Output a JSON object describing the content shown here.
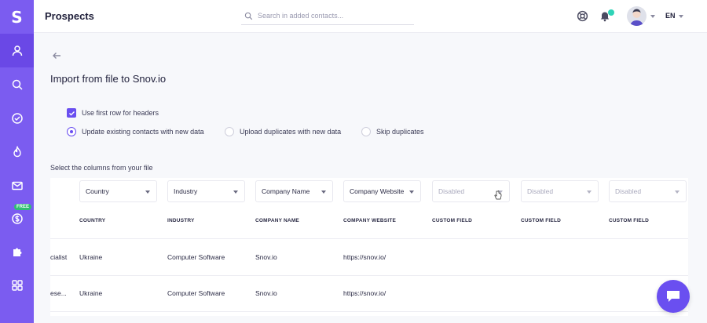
{
  "app": {
    "logo_letter": "S",
    "free_badge": "FREE"
  },
  "header": {
    "title": "Prospects",
    "search_placeholder": "Search in added contacts...",
    "language": "EN"
  },
  "sidebar": {
    "items": [
      {
        "name": "prospects",
        "icon": "person-icon",
        "active": true
      },
      {
        "name": "search",
        "icon": "search-icon",
        "active": false
      },
      {
        "name": "tasks",
        "icon": "check-circle-icon",
        "active": false
      },
      {
        "name": "drip",
        "icon": "flame-icon",
        "active": false
      },
      {
        "name": "email",
        "icon": "mail-icon",
        "active": false
      },
      {
        "name": "credits",
        "icon": "dollar-icon",
        "active": false
      },
      {
        "name": "integrations",
        "icon": "puzzle-icon",
        "active": false
      },
      {
        "name": "apps",
        "icon": "grid-icon",
        "active": false
      }
    ]
  },
  "main": {
    "heading": "Import from file to Snov.io",
    "use_first_row_label": "Use first row for headers",
    "options": [
      "Update existing contacts with new data",
      "Upload duplicates with new data",
      "Skip duplicates"
    ],
    "selected_option": "Update existing contacts with new data",
    "select_columns_label": "Select the columns from your file",
    "column_selects": [
      "Country",
      "Industry",
      "Company Name",
      "Company Website",
      "Disabled",
      "Disabled",
      "Disabled"
    ],
    "table_headers": [
      "COUNTRY",
      "INDUSTRY",
      "COMPANY NAME",
      "COMPANY WEBSITE",
      "CUSTOM FIELD",
      "CUSTOM FIELD",
      "CUSTOM FIELD"
    ],
    "rows": [
      {
        "prev": "cialist",
        "country": "Ukraine",
        "industry": "Computer Software",
        "company": "Snov.io",
        "website": "https://snov.io/"
      },
      {
        "prev": "ese...",
        "country": "Ukraine",
        "industry": "Computer Software",
        "company": "Snov.io",
        "website": "https://snov.io/"
      }
    ]
  },
  "colors": {
    "brand": "#7b5cf0",
    "brand_dark": "#6a4ff0",
    "badge_green": "#2fbf71",
    "dot_teal": "#2fd3b7"
  }
}
